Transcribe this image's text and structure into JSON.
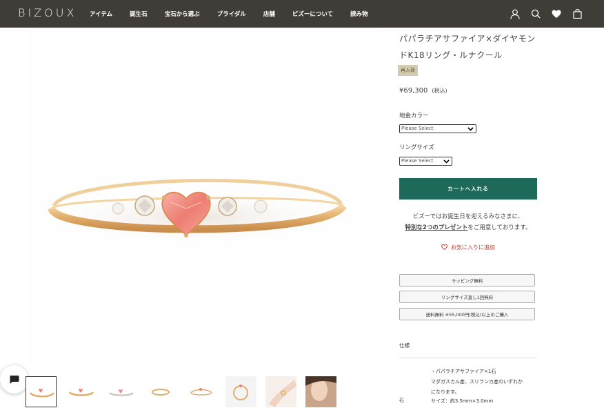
{
  "header": {
    "logo": "BIZOUX",
    "nav": [
      "アイテム",
      "誕生石",
      "宝石から選ぶ",
      "ブライダル",
      "店舗",
      "ビズーについて",
      "読み物"
    ],
    "icons": [
      "account-icon",
      "search-icon",
      "heart-icon",
      "bag-icon"
    ]
  },
  "product": {
    "title": "パパラチアサファイア×ダイヤモンドK18リング・ルナクール",
    "badge": "再入荷",
    "price": "¥69,300",
    "tax": "(税込)",
    "color_label": "地金カラー",
    "color_placeholder": "Please Select",
    "size_label": "リングサイズ",
    "size_placeholder": "Please Select",
    "cart_button": "カートへ入れる",
    "promo_line1": "ビズーではお誕生日を迎えるみなさまに、",
    "promo_link": "特別な2つのプレゼント",
    "promo_line2": "をご用意しております。",
    "favorite": "お気に入りに追加",
    "services": [
      "ラッピング無料",
      "リングサイズ直し1回無料",
      "送料無料 ※55,000円(税込)以上のご購入"
    ],
    "spec_heading": "仕様",
    "spec_label": "石",
    "spec_lines": [
      "・パパラチアサファイア×1石",
      "マダガスカル産、スリランカ産のいずれか",
      "になります。",
      "サイズ：約3.5mm×3.0mm"
    ]
  },
  "colors": {
    "header_bg": "#403c38",
    "cart_bg": "#1d6a5a",
    "badge_bg": "#d4ccb0",
    "fav": "#c0392b",
    "gold": "#e0b070",
    "stone_pink": "#f08a80"
  },
  "thumbnails": [
    "thumb-ring-front",
    "thumb-ring-front-2",
    "thumb-ring-angle",
    "thumb-ring-top",
    "thumb-ring-side",
    "thumb-ring-upright",
    "thumb-hand",
    "thumb-model"
  ]
}
